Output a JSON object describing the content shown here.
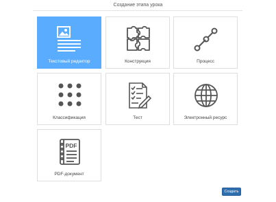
{
  "dialog": {
    "title": "Создание этапа урока"
  },
  "tiles": [
    {
      "label": "Текстовый редактор",
      "icon": "text-editor-icon",
      "selected": true
    },
    {
      "label": "Конструкция",
      "icon": "puzzle-icon",
      "selected": false
    },
    {
      "label": "Процесс",
      "icon": "process-icon",
      "selected": false
    },
    {
      "label": "Классификация",
      "icon": "classification-grid-icon",
      "selected": false
    },
    {
      "label": "Тест",
      "icon": "test-document-icon",
      "selected": false
    },
    {
      "label": "Электронный ресурс",
      "icon": "globe-icon",
      "selected": false
    },
    {
      "label": "PDF-документ",
      "icon": "pdf-document-icon",
      "selected": false
    }
  ],
  "footer": {
    "create_label": "Создать"
  },
  "colors": {
    "selected_tile": "#5aacff",
    "button": "#2f6fb0",
    "icon": "#555555"
  }
}
